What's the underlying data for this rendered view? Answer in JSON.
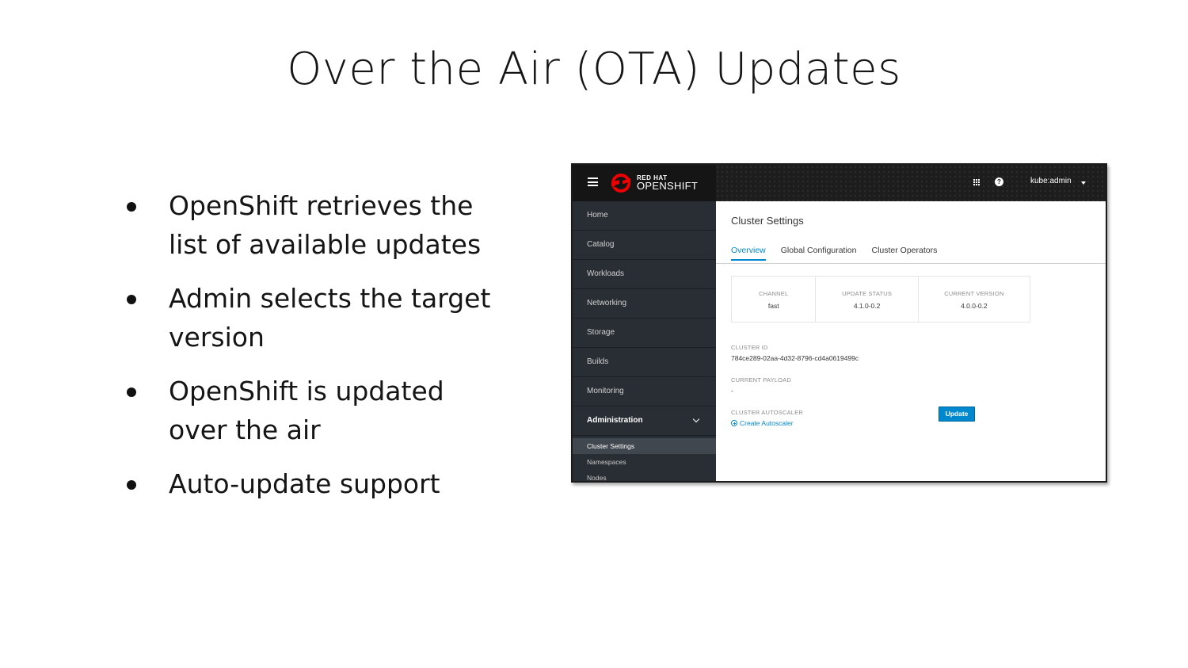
{
  "slide": {
    "title": "Over the Air (OTA) Updates",
    "bullets": [
      "OpenShift retrieves the\nlist of available updates",
      "Admin selects the target\nversion",
      "OpenShift is updated\nover the air",
      "Auto-update support"
    ]
  },
  "console": {
    "brand": {
      "top": "RED HAT",
      "main": "OPENSHIFT"
    },
    "user": "kube:admin",
    "nav": [
      "Home",
      "Catalog",
      "Workloads",
      "Networking",
      "Storage",
      "Builds",
      "Monitoring",
      "Administration"
    ],
    "subnav": [
      "Cluster Settings",
      "Namespaces",
      "Nodes"
    ],
    "page_title": "Cluster Settings",
    "tabs": [
      "Overview",
      "Global Configuration",
      "Cluster Operators"
    ],
    "summary": {
      "channel_label": "CHANNEL",
      "channel_value": "fast",
      "update_status_label": "UPDATE STATUS",
      "update_status_value": "4.1.0-0.2",
      "current_version_label": "CURRENT VERSION",
      "current_version_value": "4.0.0-0.2"
    },
    "cluster_id_label": "CLUSTER ID",
    "cluster_id_value": "784ce289-02aa-4d32-8796-cd4a0619499c",
    "current_payload_label": "CURRENT PAYLOAD",
    "current_payload_value": "-",
    "cluster_autoscaler_label": "CLUSTER AUTOSCALER",
    "create_autoscaler_link": "Create Autoscaler",
    "update_button": "Update",
    "colors": {
      "accent": "#0088ce",
      "sidebar": "#292e34",
      "masthead": "#1d1d1d",
      "logo_red": "#ee0000"
    }
  }
}
